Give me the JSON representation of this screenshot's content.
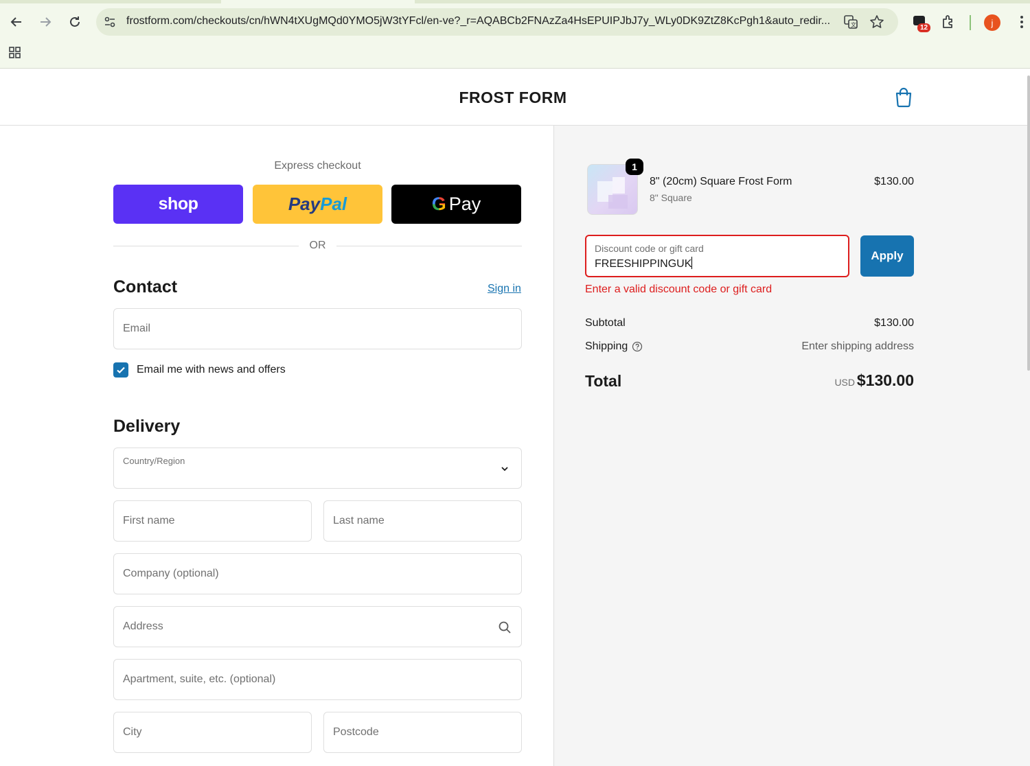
{
  "browser": {
    "url": "frostform.com/checkouts/cn/hWN4tXUgMQd0YMO5jW3tYFcl/en-ve?_r=AQABCb2FNAzZa4HsEPUIPJbJ7y_WLy0DK9ZtZ8KcPgh1&auto_redir...",
    "extension_badge_count": "12",
    "profile_initial": "j"
  },
  "store": {
    "brand": "FROST FORM"
  },
  "express": {
    "label": "Express checkout",
    "shop_label": "shop",
    "paypal_part1": "Pay",
    "paypal_part2": "Pal",
    "gpay_g": "G",
    "gpay_label": "Pay",
    "or_label": "OR"
  },
  "contact": {
    "title": "Contact",
    "signin": "Sign in",
    "email_placeholder": "Email",
    "newsletter_label": "Email me with news and offers",
    "newsletter_checked": true
  },
  "delivery": {
    "title": "Delivery",
    "country_label": "Country/Region",
    "first_name": "First name",
    "last_name": "Last name",
    "company": "Company (optional)",
    "address": "Address",
    "apartment": "Apartment, suite, etc. (optional)",
    "city": "City",
    "postcode": "Postcode"
  },
  "summary": {
    "item": {
      "quantity": "1",
      "name": "8\" (20cm) Square Frost Form",
      "variant": "8\" Square",
      "price": "$130.00"
    },
    "discount": {
      "label": "Discount code or gift card",
      "value": "FREESHIPPINGUK",
      "apply_label": "Apply",
      "error": "Enter a valid discount code or gift card"
    },
    "subtotal_label": "Subtotal",
    "subtotal_value": "$130.00",
    "shipping_label": "Shipping",
    "shipping_value": "Enter shipping address",
    "total_label": "Total",
    "total_currency": "USD",
    "total_value": "$130.00"
  },
  "colors": {
    "shop_purple": "#5a31f4",
    "paypal_yellow": "#ffc439",
    "link_blue": "#1773b0",
    "error_red": "#dd1d1d"
  }
}
